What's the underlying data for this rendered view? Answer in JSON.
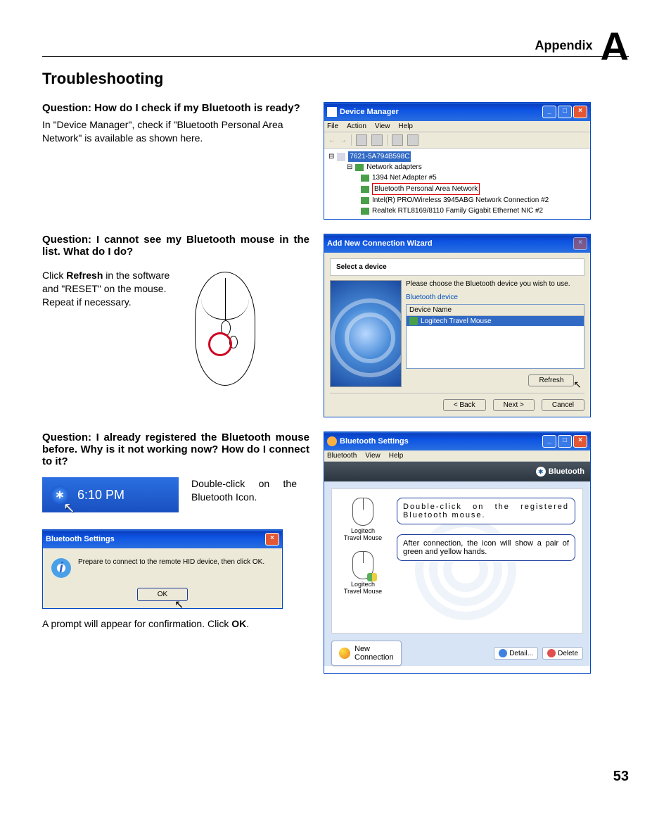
{
  "header": {
    "appendix_word": "Appendix",
    "appendix_letter": "A"
  },
  "section_title": "Troubleshooting",
  "q1": {
    "question": "Question: How do I check if my Bluetooth is ready?",
    "answer": "In \"Device Manager\", check if \"Bluetooth Personal Area Network\" is available as shown here."
  },
  "q2": {
    "question": "Question: I cannot see my Bluetooth mouse in the list. What do I do?",
    "answer_pre": "Click ",
    "answer_bold": "Refresh",
    "answer_post": " in the software and \"RESET\" on the mouse. Repeat if necessary."
  },
  "q3": {
    "question": "Question: I already registered the Bluetooth mouse before. Why is it not working now? How do I connect to it?",
    "step1": "Double-click on the Bluetooth Icon.",
    "tray_time": "6:10 PM",
    "dialog_title": "Bluetooth Settings",
    "dialog_msg": "Prepare to connect to the remote HID device, then click OK.",
    "ok_label": "OK",
    "caption_pre": "A prompt will appear for confirmation. Click ",
    "caption_bold": "OK",
    "caption_post": "."
  },
  "dm_window": {
    "title": "Device Manager",
    "menu": [
      "File",
      "Action",
      "View",
      "Help"
    ],
    "root": "7621-5A794B598C",
    "group": "Network adapters",
    "items": [
      "1394 Net Adapter #5",
      "Bluetooth Personal Area Network",
      "Intel(R) PRO/Wireless 3945ABG Network Connection #2",
      "Realtek RTL8169/8110 Family Gigabit Ethernet NIC #2"
    ],
    "highlighted_index": 1
  },
  "wizard": {
    "title": "Add New Connection Wizard",
    "subtitle": "Select a device",
    "instruction": "Please choose the Bluetooth device you wish to use.",
    "group_label": "Bluetooth device",
    "column": "Device Name",
    "device": "Logitech Travel Mouse",
    "refresh": "Refresh",
    "back": "< Back",
    "next": "Next >",
    "cancel": "Cancel"
  },
  "bts_window": {
    "title": "Bluetooth Settings",
    "menu": [
      "Bluetooth",
      "View",
      "Help"
    ],
    "brand": "Bluetooth",
    "device_label": "Logitech\nTravel Mouse",
    "note1": "Double-click on the registered Bluetooth mouse.",
    "note2": "After connection, the icon will show a pair of green and yellow hands.",
    "new_conn": "New\nConnection",
    "detail": "Detail...",
    "delete": "Delete"
  },
  "page_number": "53"
}
